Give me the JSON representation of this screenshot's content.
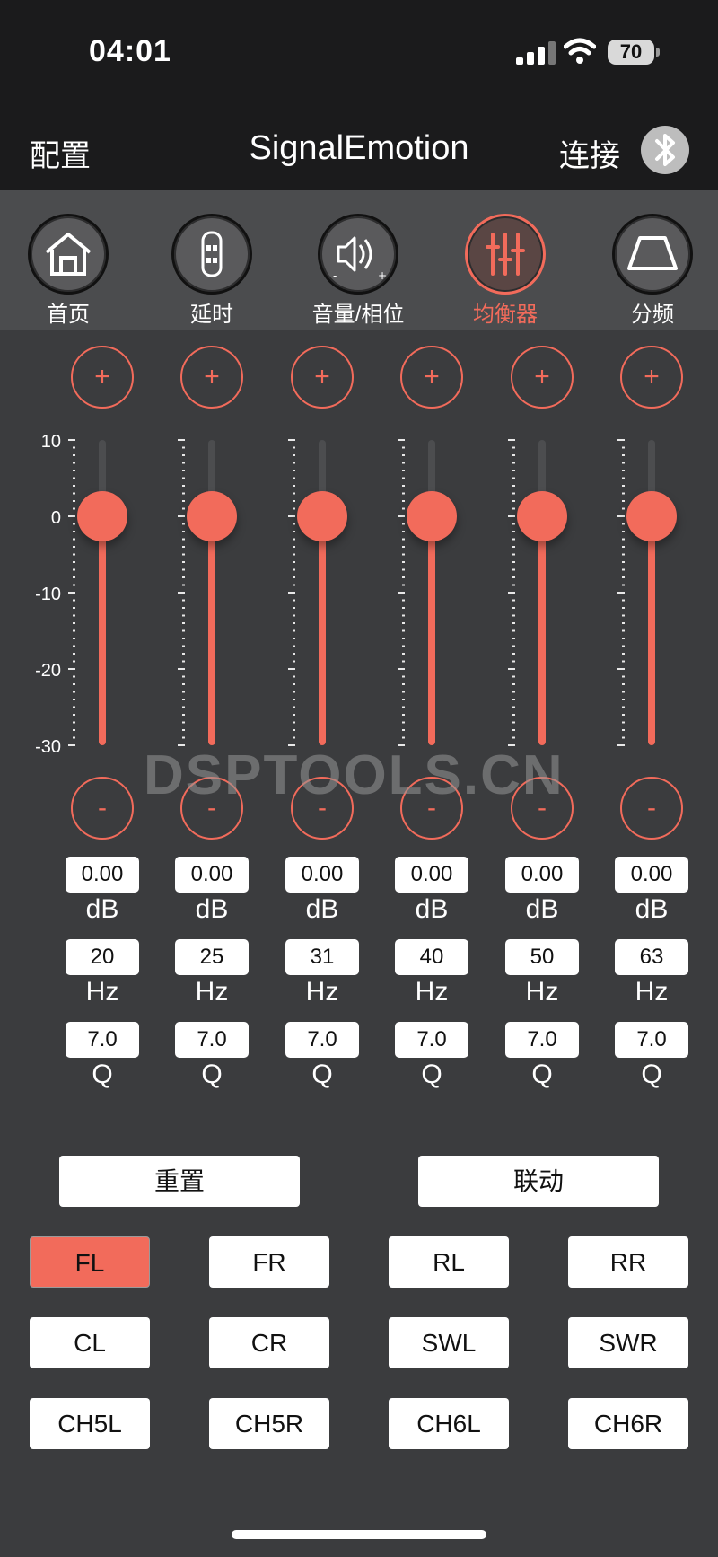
{
  "status": {
    "time": "04:01",
    "battery": "70"
  },
  "header": {
    "left": "配置",
    "title": "SignalEmotion",
    "right": "连接"
  },
  "tabs": [
    {
      "label": "首页",
      "icon": "home-icon"
    },
    {
      "label": "延时",
      "icon": "car-seat-icon"
    },
    {
      "label": "音量/相位",
      "icon": "speaker-phase-icon"
    },
    {
      "label": "均衡器",
      "icon": "equalizer-icon",
      "active": true
    },
    {
      "label": "分频",
      "icon": "crossover-icon"
    }
  ],
  "eq": {
    "plus": "+",
    "minus": "-",
    "scale": [
      "10",
      "0",
      "-10",
      "-20",
      "-30"
    ],
    "range_db": [
      -30,
      10
    ],
    "bands": [
      {
        "gain": "0.00",
        "gain_unit": "dB",
        "freq": "20",
        "freq_unit": "Hz",
        "q": "7.0",
        "q_unit": "Q",
        "level_db": 0
      },
      {
        "gain": "0.00",
        "gain_unit": "dB",
        "freq": "25",
        "freq_unit": "Hz",
        "q": "7.0",
        "q_unit": "Q",
        "level_db": 0
      },
      {
        "gain": "0.00",
        "gain_unit": "dB",
        "freq": "31",
        "freq_unit": "Hz",
        "q": "7.0",
        "q_unit": "Q",
        "level_db": 0
      },
      {
        "gain": "0.00",
        "gain_unit": "dB",
        "freq": "40",
        "freq_unit": "Hz",
        "q": "7.0",
        "q_unit": "Q",
        "level_db": 0
      },
      {
        "gain": "0.00",
        "gain_unit": "dB",
        "freq": "50",
        "freq_unit": "Hz",
        "q": "7.0",
        "q_unit": "Q",
        "level_db": 0
      },
      {
        "gain": "0.00",
        "gain_unit": "dB",
        "freq": "63",
        "freq_unit": "Hz",
        "q": "7.0",
        "q_unit": "Q",
        "level_db": 0
      }
    ]
  },
  "watermark": "DSPTOOLS.CN",
  "actions": {
    "reset": "重置",
    "link": "联动"
  },
  "channels": [
    {
      "label": "FL",
      "active": true
    },
    {
      "label": "FR"
    },
    {
      "label": "RL"
    },
    {
      "label": "RR"
    },
    {
      "label": "CL"
    },
    {
      "label": "CR"
    },
    {
      "label": "SWL"
    },
    {
      "label": "SWR"
    },
    {
      "label": "CH5L"
    },
    {
      "label": "CH5R"
    },
    {
      "label": "CH6L"
    },
    {
      "label": "CH6R"
    }
  ],
  "colors": {
    "accent": "#f26b5b",
    "background": "#3b3c3e",
    "header": "#1b1b1c"
  }
}
